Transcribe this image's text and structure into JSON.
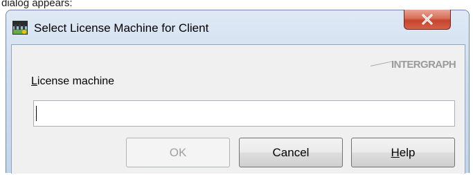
{
  "background_text": "dialog appears:",
  "window": {
    "title": "Select License Machine for Client",
    "title_icon": "application-icon",
    "close_label": "X"
  },
  "brand": {
    "logo_text": "INTERGRAPH"
  },
  "form": {
    "label_mnemonic": "L",
    "label_rest": "icense machine",
    "input_value": ""
  },
  "buttons": {
    "ok_label": "OK",
    "ok_enabled": false,
    "cancel_label": "Cancel",
    "help_mnemonic": "H",
    "help_rest": "elp"
  },
  "colors": {
    "close_button": "#c7432b",
    "title_bar": "#cfdeef",
    "client_area": "#f0f0f0"
  }
}
